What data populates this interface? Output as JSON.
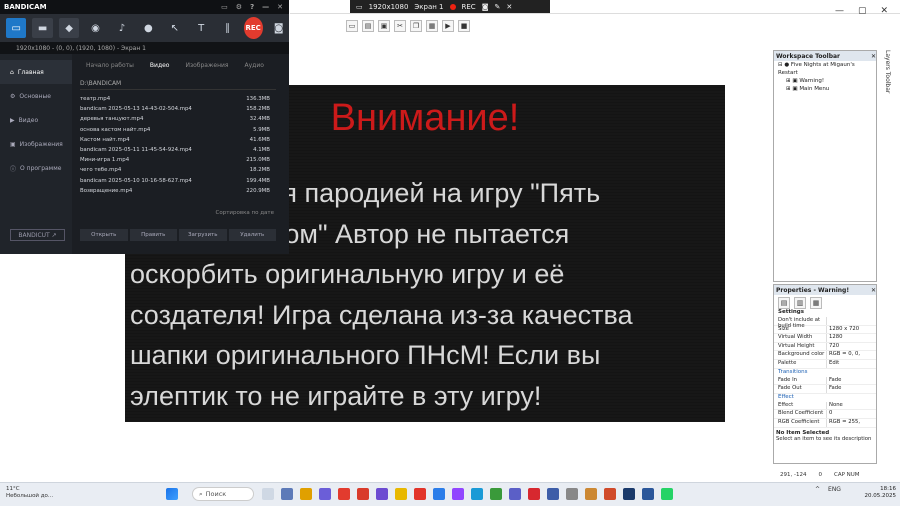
{
  "ide": {
    "rec_bar": {
      "resolution": "1920x1080",
      "screen": "Экран 1",
      "rec_label": "REC"
    },
    "toolbar_icons": [
      "new-icon",
      "open-icon",
      "save-icon",
      "cut-icon",
      "copy-icon",
      "paste-icon",
      "play-icon",
      "stop-icon"
    ],
    "workspace": {
      "title": "Workspace Toolbar",
      "root": "Five Nights at Migaun's Restart",
      "children": [
        "Warning!",
        "Main Menu"
      ]
    },
    "layers_label": "Layers Toolbar",
    "properties": {
      "title": "Properties - Warning!",
      "section_settings": "Settings",
      "rows": [
        {
          "k": "Don't include at build time",
          "v": ""
        },
        {
          "k": "Size",
          "v": "1280 x 720"
        },
        {
          "k": "Virtual Width",
          "v": "1280"
        },
        {
          "k": "Virtual Height",
          "v": "720"
        },
        {
          "k": "Background color",
          "v": "RGB = 0, 0,"
        },
        {
          "k": "Palette",
          "v": "Edit"
        }
      ],
      "section_transitions": "Transitions",
      "rows2": [
        {
          "k": "Fade In",
          "v": "Fade"
        },
        {
          "k": "Fade Out",
          "v": "Fade"
        }
      ],
      "section_effect": "Effect",
      "rows3": [
        {
          "k": "Effect",
          "v": "None"
        },
        {
          "k": "Blend Coefficient",
          "v": "0"
        },
        {
          "k": "RGB Coefficient",
          "v": "RGB = 255,"
        }
      ],
      "no_item": "No Item Selected",
      "hint": "Select an item to see its description"
    },
    "status": {
      "coords": "291, -124",
      "zero": "0",
      "caps": "CAP NUM"
    }
  },
  "game": {
    "title": "Внимание!",
    "body": "Это является пародией на игру \"Пять\nночей с гауном\" Автор не пытается\nоскорбить оригинальную игру и её\nсоздателя! Игра сделана из-за качества\nшапки оригинального ПНсМ! Если вы\nэлептик то не играйте в эту игру!",
    "bg_color": "#000000",
    "title_color": "#cc1a1a"
  },
  "bandicam": {
    "title": "BANDICAM",
    "modes": [
      "monitor-icon",
      "hdmi-icon",
      "gamepad-icon"
    ],
    "rec_label": "REC",
    "info": "1920x1080 - (0, 0), (1920, 1080) - Экран 1",
    "sidebar": [
      "Главная",
      "Основные",
      "Видео",
      "Изображения",
      "О программе"
    ],
    "subtabs": [
      "Начало работы",
      "Видео",
      "Изображения",
      "Аудио"
    ],
    "path": "D:\\BANDICAM",
    "files": [
      {
        "name": "театр.mp4",
        "size": "136.3MB"
      },
      {
        "name": "bandicam 2025-05-13 14-43-02-504.mp4",
        "size": "158.2MB"
      },
      {
        "name": "деревья танцуют.mp4",
        "size": "32.4MB"
      },
      {
        "name": "основа кастом найт.mp4",
        "size": "5.9MB"
      },
      {
        "name": "Кастом найт.mp4",
        "size": "41.6MB"
      },
      {
        "name": "bandicam 2025-05-11 11-45-54-924.mp4",
        "size": "4.1MB"
      },
      {
        "name": "Мини-игра 1.mp4",
        "size": "215.0MB"
      },
      {
        "name": "чего тебе.mp4",
        "size": "18.2MB"
      },
      {
        "name": "bandicam 2025-05-10 10-16-58-627.mp4",
        "size": "199.4MB"
      },
      {
        "name": "Возвращение.mp4",
        "size": "220.9MB"
      }
    ],
    "sort_label": "Сортировка по дате",
    "actions": [
      "Открыть",
      "Править",
      "Загрузить",
      "Удалить"
    ],
    "bandicut": "BANDICUT ↗"
  },
  "taskbar": {
    "weather_temp": "11°C",
    "weather_desc": "Небольшой до...",
    "search": "Поиск",
    "lang": "ENG",
    "time": "18:16",
    "date": "20.05.2025"
  }
}
